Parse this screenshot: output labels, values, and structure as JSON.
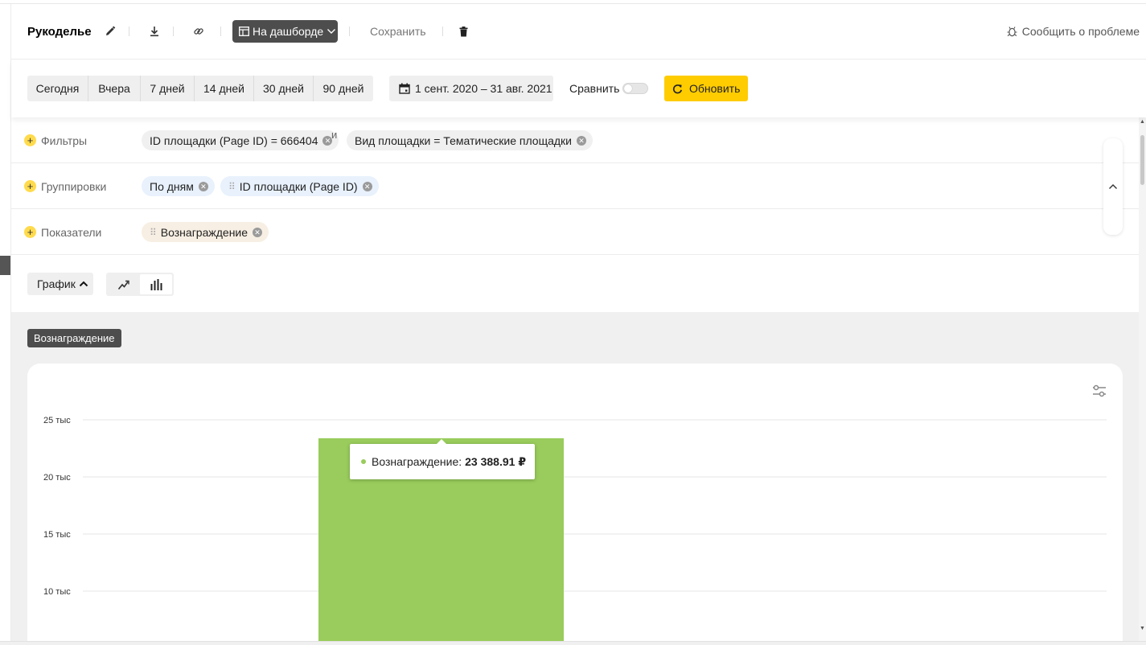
{
  "header": {
    "title": "Рукоделье",
    "dashboard_label": "На дашборде",
    "save_label": "Сохранить",
    "report_label": "Сообщить о проблеме"
  },
  "period": {
    "presets": [
      "Сегодня",
      "Вчера",
      "7 дней",
      "14 дней",
      "30 дней",
      "90 дней"
    ],
    "date_range": "1 сент. 2020 – 31 авг. 2021",
    "compare_label": "Сравнить",
    "compare_enabled": false,
    "refresh_label": "Обновить"
  },
  "filters": {
    "label": "Фильтры",
    "chip1_text": "ID площадки (Page ID) = ",
    "chip1_value": "666404",
    "and_label": "и",
    "chip2_text": "Вид площадки = ",
    "chip2_value": "Тематические площадки"
  },
  "groupings": {
    "label": "Группировки",
    "chip1": "По дням",
    "chip2": "ID площадки (Page ID)"
  },
  "metrics": {
    "label": "Показатели",
    "chip1": "Вознаграждение"
  },
  "chart_toolbar": {
    "graph_label": "График",
    "active_view": "bar"
  },
  "colors": {
    "accent": "#ffcc00",
    "dark": "#4d4d4d",
    "bar": "#99cc5c"
  },
  "icons": [
    "edit-icon",
    "download-icon",
    "link-icon",
    "dashboard-icon",
    "chevron-down-icon",
    "trash-icon",
    "bug-icon",
    "calendar-icon",
    "refresh-icon",
    "plus-icon",
    "remove-icon",
    "drag-handle-icon",
    "chevron-up-icon",
    "line-chart-icon",
    "bar-chart-icon",
    "settings-sliders-icon"
  ],
  "chart_data": {
    "type": "bar",
    "title": "Вознаграждение",
    "series": [
      {
        "name": "Вознаграждение",
        "values": [
          23388.91
        ]
      }
    ],
    "y_ticks": [
      "25 тыс",
      "20 тыс",
      "15 тыс",
      "10 тыс"
    ],
    "y_tick_values": [
      25000,
      20000,
      15000,
      10000
    ],
    "ylim_visible": [
      8000,
      25000
    ],
    "grid": true,
    "tooltip": {
      "label": "Вознаграждение:",
      "value": "23 388.91 ₽"
    }
  }
}
